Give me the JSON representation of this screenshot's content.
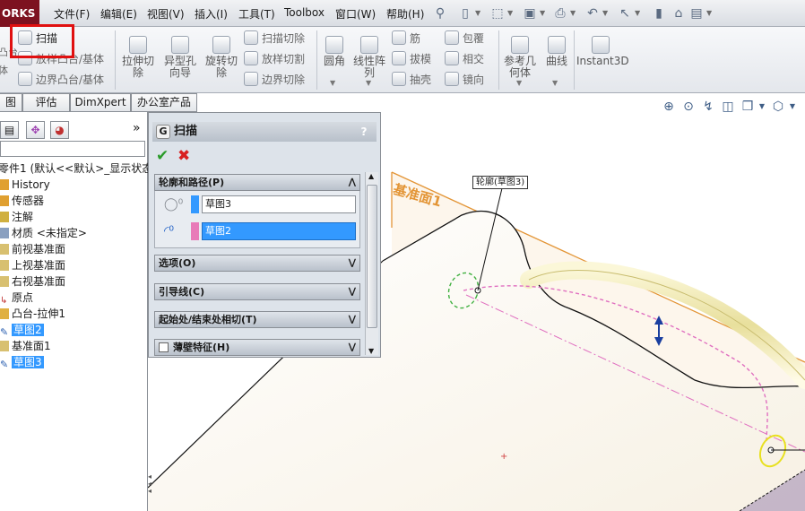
{
  "app": {
    "logo_text": "ORKS"
  },
  "menu": {
    "items": [
      {
        "label": "文件(F)"
      },
      {
        "label": "编辑(E)"
      },
      {
        "label": "视图(V)"
      },
      {
        "label": "插入(I)"
      },
      {
        "label": "工具(T)"
      },
      {
        "label": "Toolbox"
      },
      {
        "label": "窗口(W)"
      },
      {
        "label": "帮助(H)"
      }
    ],
    "quick_access_icons": [
      "pin-icon",
      "new-document-icon",
      "open-icon",
      "save-icon",
      "print-icon",
      "undo-icon",
      "select-arrow-icon",
      "rebuild-icon",
      "file-properties-icon",
      "options-icon"
    ]
  },
  "commands": {
    "sweep": "扫描",
    "loft_boss": "放样凸台/基体",
    "boundary_boss": "边界凸台/基体",
    "extruded_cut": "拉伸切除",
    "hole_wizard": "异型孔向导",
    "revolved_cut": "旋转切除",
    "swept_cut": "扫描切除",
    "lofted_cut": "放样切割",
    "boundary_cut": "边界切除",
    "fillet": "圆角",
    "linear_pattern": "线性阵列",
    "rib": "筋",
    "draft": "拔模",
    "shell": "抽壳",
    "wrap": "包覆",
    "intersect": "相交",
    "mirror": "镜向",
    "ref_geometry": "参考几何体",
    "curves": "曲线",
    "instant3d": "Instant3D",
    "left_partial_top": "凸台",
    "left_partial_bottom": "体"
  },
  "tabs": [
    {
      "label": "图"
    },
    {
      "label": "评估"
    },
    {
      "label": "DimXpert"
    },
    {
      "label": "办公室产品"
    }
  ],
  "feature_tree": {
    "root": "零件1 (默认<<默认>_显示状态",
    "items": [
      {
        "label": "History",
        "selected": false
      },
      {
        "label": "传感器",
        "selected": false
      },
      {
        "label": "注解",
        "selected": false
      },
      {
        "label": "材质 <未指定>",
        "selected": false
      },
      {
        "label": "前视基准面",
        "selected": false
      },
      {
        "label": "上视基准面",
        "selected": false
      },
      {
        "label": "右视基准面",
        "selected": false
      },
      {
        "label": "原点",
        "selected": false
      },
      {
        "label": "凸台-拉伸1",
        "selected": false
      },
      {
        "label": "草图2",
        "selected": true
      },
      {
        "label": "基准面1",
        "selected": false
      },
      {
        "label": "草图3",
        "selected": true
      }
    ],
    "expand_arrow": "»"
  },
  "property_manager": {
    "title": "扫描",
    "help": "?",
    "ok_symbol": "✔",
    "cancel_symbol": "✖",
    "groups": [
      {
        "label": "轮廓和路径(P)",
        "chevron": "⋀"
      },
      {
        "label": "选项(O)",
        "chevron": "⋁"
      },
      {
        "label": "引导线(C)",
        "chevron": "⋁"
      },
      {
        "label": "起始处/结束处相切(T)",
        "chevron": "⋁"
      },
      {
        "label": "薄壁特征(H)",
        "chevron": "⋁"
      }
    ],
    "profile_value": "草图3",
    "path_value": "草图2",
    "profile_color": "#3399ff",
    "path_color": "#e87ab8"
  },
  "graphics": {
    "callout": "轮廓(草图3)",
    "plane_label": "基准面1"
  },
  "colors": {
    "accent": "#3399ff",
    "highlight": "#e01010",
    "plane_orange": "#e39536"
  }
}
